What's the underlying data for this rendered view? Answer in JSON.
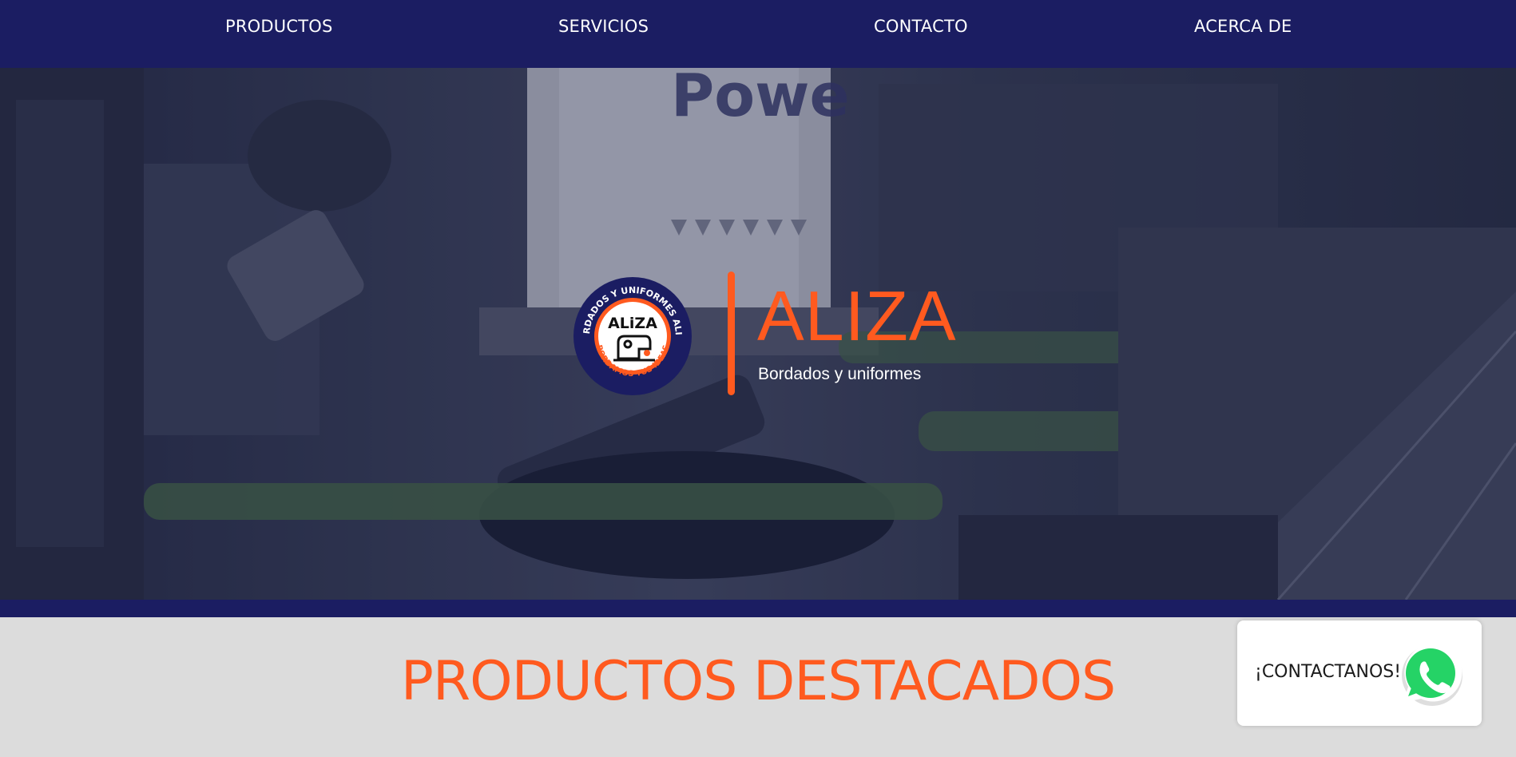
{
  "nav": {
    "items": [
      {
        "label": "PRODUCTOS"
      },
      {
        "label": "SERVICIOS"
      },
      {
        "label": "CONTACTO"
      },
      {
        "label": "ACERCA DE"
      }
    ]
  },
  "hero": {
    "logo_ring_text_top": "BORDADOS Y UNIFORMES ALIZA",
    "logo_ring_text_bottom": "BORDAMOS TUS IDEAS",
    "logo_center_text": "ALiZA",
    "brand": "ALIZA",
    "tagline": "Bordados y uniformes"
  },
  "section": {
    "title": "PRODUCTOS DESTACADOS"
  },
  "whatsapp": {
    "label": "¡CONTACTANOS!",
    "icon": "whatsapp-icon"
  },
  "colors": {
    "nav_bg": "#1b1d62",
    "accent": "#ff5a1f",
    "section_bg": "#dcdcdc",
    "whatsapp_green": "#25d366"
  }
}
